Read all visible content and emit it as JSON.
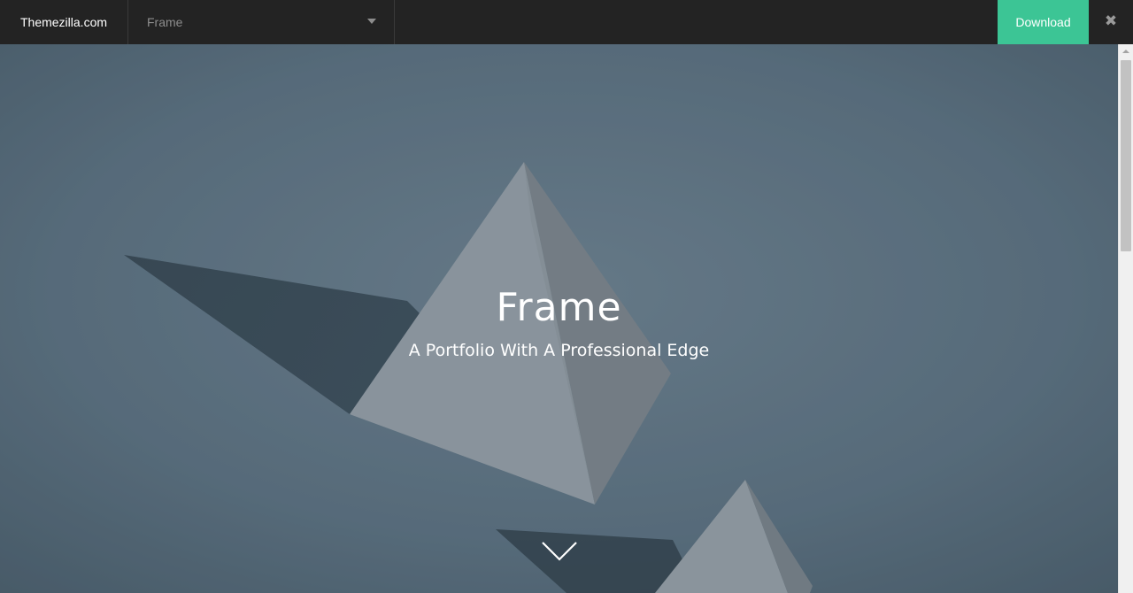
{
  "topbar": {
    "brand": "Themezilla.com",
    "theme_select": {
      "selected": "Frame"
    },
    "download_label": "Download",
    "close_glyph": "✖",
    "colors": {
      "bar_bg": "#232323",
      "download_bg": "#3cc595"
    }
  },
  "hero": {
    "title": "Frame",
    "subtitle": "A Portfolio With A Professional Edge",
    "scroll_icon": "chevron-down-icon",
    "colors": {
      "backdrop": "#5c7080"
    }
  },
  "scrollbar": {
    "position": 0.0
  }
}
